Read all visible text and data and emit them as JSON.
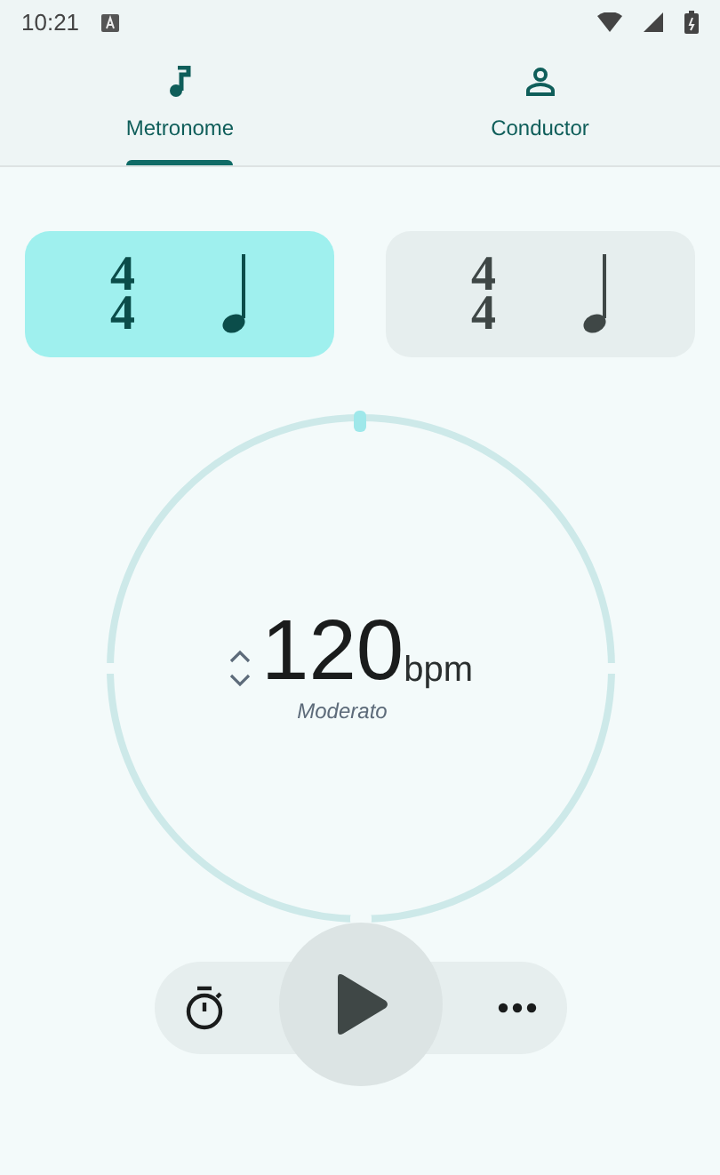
{
  "status_bar": {
    "time": "10:21"
  },
  "tabs": [
    {
      "label": "Metronome",
      "selected": true
    },
    {
      "label": "Conductor",
      "selected": false
    }
  ],
  "beat_cards": [
    {
      "numerator": "4",
      "denominator": "4",
      "selected": true
    },
    {
      "numerator": "4",
      "denominator": "4",
      "selected": false
    }
  ],
  "tempo": {
    "value": "120",
    "unit": "bpm",
    "marking": "Moderato"
  },
  "controls": {
    "playing": false
  }
}
